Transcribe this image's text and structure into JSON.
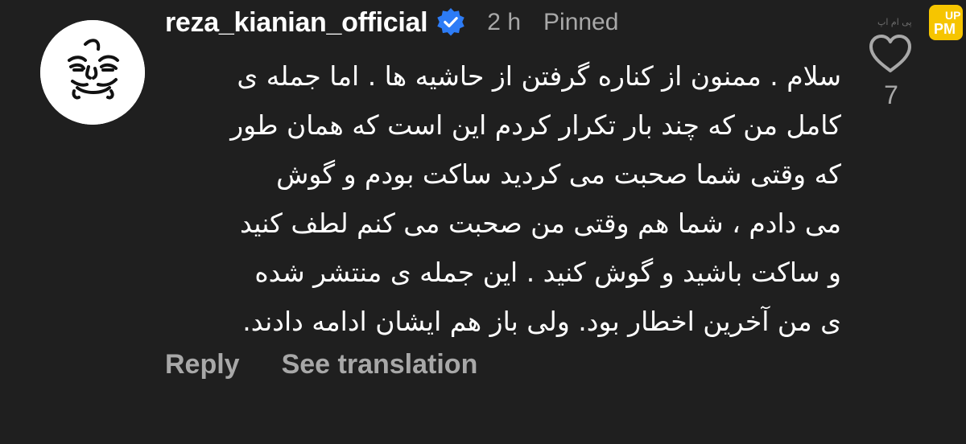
{
  "comment": {
    "username": "reza_kianian_official",
    "time": "2 h",
    "pinned_label": "Pinned",
    "lines": [
      "سلام . ممنون از کناره گرفتن از حاشیه ها . اما جمله ی",
      "کامل من که چند بار تکرار کردم این است که همان طور",
      "که وقتی شما صحبت می کردید ساکت بودم و گوش",
      "می دادم ، شما هم وقتی من صحبت می کنم لطف کنید",
      "و ساکت باشید و گوش کنید . این جمله ی  منتشر شده",
      "ی من آخرین اخطار بود. ولی باز هم ایشان ادامه دادند."
    ],
    "like_count": "7"
  },
  "actions": {
    "reply_label": "Reply",
    "translate_label": "See translation"
  },
  "icons": {
    "verified": "verified-badge-icon",
    "like": "heart-outline-icon"
  },
  "watermark": {
    "text": "پی ام اپ"
  },
  "colors": {
    "background": "#1f1f1f",
    "primary_text": "#ffffff",
    "secondary_text": "#a8a8a8",
    "verified_blue": "#2d7cf6",
    "watermark_yellow": "#f6c500"
  }
}
